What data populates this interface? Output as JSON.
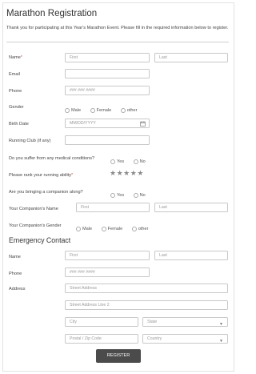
{
  "form": {
    "title": "Marathon Registration",
    "description": "Thank you for participating at this Year's Marathon Event. Please fill in the required information below to register.",
    "name_label": "Name",
    "name_first_placeholder": "First",
    "name_last_placeholder": "Last",
    "email_label": "Email",
    "phone_label": "Phone",
    "phone_placeholder": "### ### ####",
    "gender_label": "Gender",
    "gender_options": [
      "Male",
      "Female",
      "other"
    ],
    "birth_date_label": "Birth Date",
    "birth_date_placeholder": "MM/DD/YYYY",
    "running_club_label": "Running Club (if any)",
    "medical_label": "Do you suffer from any medical conditions?",
    "yes_label": "Yes",
    "no_label": "No",
    "rank_label": "Please rank your running ability",
    "rating_max": 5,
    "rating_value": 0,
    "companion_label": "Are you bringing a companion along?",
    "companion_name_label": "Your Companion's Name",
    "companion_gender_label": "Your Companion's Gender",
    "companion_gender_options": [
      "Male",
      "Female",
      "other"
    ]
  },
  "emergency": {
    "section_title": "Emergency Contact",
    "name_label": "Name",
    "first_placeholder": "First",
    "last_placeholder": "Last",
    "phone_label": "Phone",
    "phone_placeholder": "### ### ####",
    "address_label": "Address",
    "street_placeholder": "Street Address",
    "street2_placeholder": "Street Address Line 2",
    "city_placeholder": "City",
    "state_placeholder": "State",
    "postal_placeholder": "Postal / Zip Code",
    "country_placeholder": "Country"
  },
  "submit_label": "REGISTER",
  "colors": {
    "required": "#d9534f",
    "button": "#4b4b4b",
    "border": "#c8c8c8"
  },
  "icons": {
    "calendar": "calendar-icon",
    "dropdown": "chevron-down-icon",
    "star": "star-icon"
  }
}
